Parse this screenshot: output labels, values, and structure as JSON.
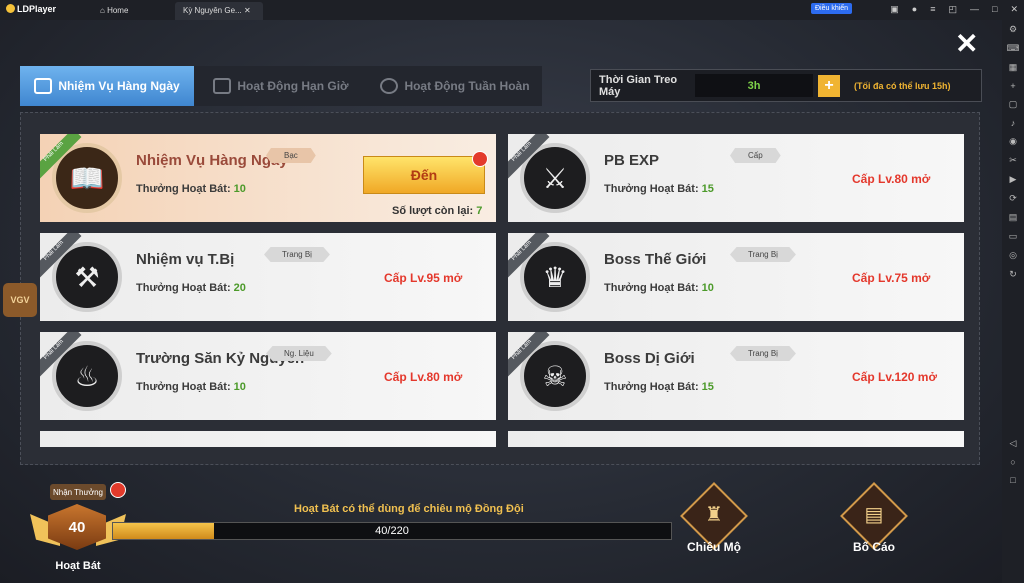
{
  "app": {
    "name": "LDPlayer"
  },
  "tabs": [
    {
      "label": "Home"
    },
    {
      "label": "Kỳ Nguyên Ge..."
    }
  ],
  "titlebar": {
    "control_btn": "Điều khiển"
  },
  "game": {
    "tabs": [
      {
        "label": "Nhiệm Vụ Hàng Ngày"
      },
      {
        "label": "Hoạt Động Hạn Giờ"
      },
      {
        "label": "Hoạt Động Tuần Hoàn"
      }
    ],
    "idle": {
      "label": "Thời Gian Treo Máy",
      "value": "3h",
      "plus": "+",
      "note": "(Tối đa có thể lưu 15h)"
    },
    "ribbon": "Phải Làm",
    "tasks": [
      {
        "name": "Nhiệm Vụ Hàng Ngày",
        "tag": "Bạc",
        "reward_label": "Thưởng Hoạt Bát:",
        "reward": "10",
        "button": "Đến",
        "remain_label": "Số lượt còn lại:",
        "remain": "7"
      },
      {
        "name": "PB EXP",
        "tag": "Cấp",
        "reward_label": "Thưởng Hoạt Bát:",
        "reward": "15",
        "unlock": "Cấp Lv.80 mở"
      },
      {
        "name": "Nhiệm vụ T.Bị",
        "tag": "Trang Bị",
        "reward_label": "Thưởng Hoạt Bát:",
        "reward": "20",
        "unlock": "Cấp Lv.95 mở"
      },
      {
        "name": "Boss Thế Giới",
        "tag": "Trang Bị",
        "reward_label": "Thưởng Hoạt Bát:",
        "reward": "10",
        "unlock": "Cấp Lv.75 mở"
      },
      {
        "name": "Trường Săn Kỷ Nguyên",
        "tag": "Ng. Liệu",
        "reward_label": "Thưởng Hoạt Bát:",
        "reward": "10",
        "unlock": "Cấp Lv.80 mở"
      },
      {
        "name": "Boss Dị Giới",
        "tag": "Trang Bị",
        "reward_label": "Thưởng Hoạt Bát:",
        "reward": "15",
        "unlock": "Cấp Lv.120 mở"
      }
    ],
    "badge": {
      "top": "Nhận Thưởng",
      "level": "40",
      "label": "Hoạt Bát"
    },
    "progress": {
      "desc": "Hoạt Bát có thể dùng để chiêu mộ Đồng Đội",
      "text": "40/220",
      "current": 40,
      "max": 220
    },
    "buttons": {
      "recruit": "Chiêu Mộ",
      "report": "Bố Cáo"
    },
    "side_logo": "VGV",
    "close": "✕"
  }
}
